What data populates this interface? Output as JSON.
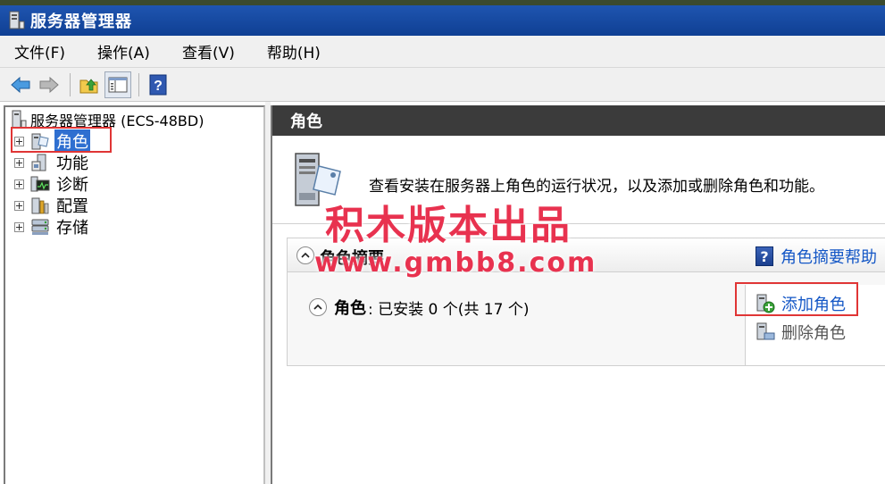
{
  "window": {
    "title": "服务器管理器",
    "icon": "server-manager-icon"
  },
  "menubar": {
    "items": [
      "文件(F)",
      "操作(A)",
      "查看(V)",
      "帮助(H)"
    ]
  },
  "toolbar": {
    "buttons": [
      "back-arrow-icon",
      "forward-arrow-icon",
      "up-folder-icon",
      "show-hide-console-tree-icon",
      "help-icon"
    ]
  },
  "tree": {
    "root_label": "服务器管理器 (ECS-48BD)",
    "items": [
      {
        "label": "角色",
        "icon": "roles-icon",
        "selected": true
      },
      {
        "label": "功能",
        "icon": "features-icon",
        "selected": false
      },
      {
        "label": "诊断",
        "icon": "diagnostics-icon",
        "selected": false
      },
      {
        "label": "配置",
        "icon": "configuration-icon",
        "selected": false
      },
      {
        "label": "存储",
        "icon": "storage-icon",
        "selected": false
      }
    ]
  },
  "content": {
    "header": "角色",
    "intro_text": "查看安装在服务器上角色的运行状况，以及添加或删除角色和功能。",
    "summary": {
      "title": "角色摘要",
      "help_link": "角色摘要帮助",
      "roles_label": "角色",
      "roles_status": ": 已安装 0 个(共 17 个)",
      "actions": [
        {
          "label": "添加角色",
          "enabled": true
        },
        {
          "label": "删除角色",
          "enabled": false
        }
      ]
    }
  },
  "watermark": {
    "title": "积木版本出品",
    "url": "www.gmbb8.com"
  },
  "colors": {
    "titlebar": "#1f55b0",
    "selection": "#2f6fd0",
    "link": "#1457c6",
    "highlight": "#e03535",
    "watermark": "#e8324f",
    "content_header": "#3b3b3b"
  }
}
